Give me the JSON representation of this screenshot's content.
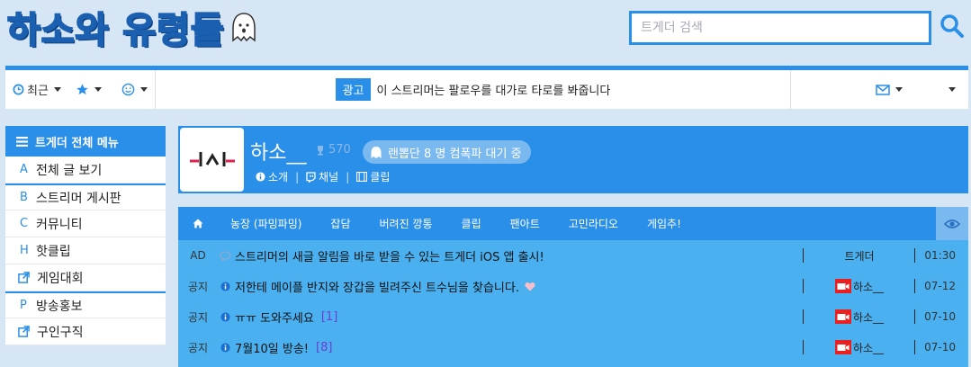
{
  "header": {
    "logo_text": "하소와 유령들",
    "search_placeholder": "트게더 검색"
  },
  "topbar": {
    "recent_label": "최근",
    "ad_badge": "광고",
    "ad_text": "이 스트리머는 팔로우를 대가로 타로를 봐줍니다"
  },
  "sidebar": {
    "title": "트게더 전체 메뉴",
    "items": [
      {
        "prefix": "A",
        "label": "전체 글 보기"
      },
      {
        "prefix": "B",
        "label": "스트리머 게시판"
      },
      {
        "prefix": "C",
        "label": "커뮤니티"
      },
      {
        "prefix": "H",
        "label": "핫클립"
      },
      {
        "prefix": "external-link-icon",
        "label": "게임대회"
      },
      {
        "prefix": "P",
        "label": "방송홍보"
      },
      {
        "prefix": "external-link-icon",
        "label": "구인구직"
      }
    ]
  },
  "streamer": {
    "name": "하소__",
    "trophy_count": "570",
    "status_pill": "랜뽑단 8 명 컴폭파 대기 중",
    "links": [
      "소개",
      "채널",
      "클립"
    ]
  },
  "board": {
    "tabs": [
      "농장 (파밍파밍)",
      "잡담",
      "버려진 깡통",
      "클립",
      "팬아트",
      "고민라디오",
      "게임추!"
    ],
    "rows": [
      {
        "kind": "AD",
        "title": "스트리머의 새글 알림을 바로 받을 수 있는 트게더 iOS 앱 출시!",
        "count": "",
        "author": "트게더",
        "date": "01:30",
        "icon": "chat-bubble-icon",
        "heart": false,
        "cam": false
      },
      {
        "kind": "공지",
        "title": "저한테 메이플 반지와 장갑을 빌려주신 트수님을 찾습니다.",
        "count": "",
        "author": "하소__",
        "date": "07-12",
        "icon": "info-icon",
        "heart": true,
        "cam": true
      },
      {
        "kind": "공지",
        "title": "ㅠㅠ 도와주세요",
        "count": "[1]",
        "author": "하소__",
        "date": "07-10",
        "icon": "info-icon",
        "heart": false,
        "cam": true
      },
      {
        "kind": "공지",
        "title": "7월10일 방송!",
        "count": "[8]",
        "author": "하소__",
        "date": "07-10",
        "icon": "info-icon",
        "heart": false,
        "cam": true
      }
    ]
  },
  "colors": {
    "accent": "#2a8fe8",
    "background": "#d6e6f5",
    "board": "#4ab0f0"
  }
}
